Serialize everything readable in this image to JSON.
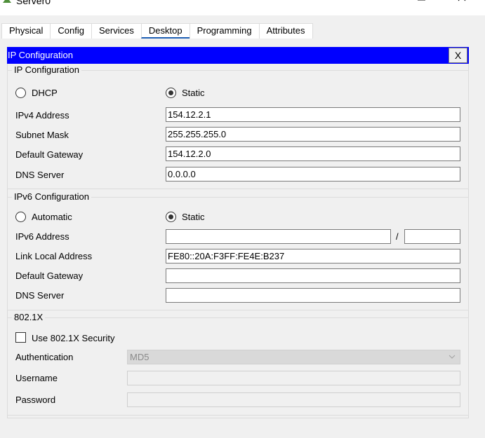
{
  "window": {
    "title": "Server0"
  },
  "tabs": [
    "Physical",
    "Config",
    "Services",
    "Desktop",
    "Programming",
    "Attributes"
  ],
  "active_tab": "Desktop",
  "panel": {
    "title": "IP Configuration",
    "close_label": "X"
  },
  "ipv4": {
    "legend": "IP Configuration",
    "dhcp_label": "DHCP",
    "static_label": "Static",
    "mode": "Static",
    "ipv4_address_label": "IPv4 Address",
    "ipv4_address": "154.12.2.1",
    "subnet_mask_label": "Subnet Mask",
    "subnet_mask": "255.255.255.0",
    "default_gateway_label": "Default Gateway",
    "default_gateway": "154.12.2.0",
    "dns_server_label": "DNS Server",
    "dns_server": "0.0.0.0"
  },
  "ipv6": {
    "legend": "IPv6 Configuration",
    "automatic_label": "Automatic",
    "static_label": "Static",
    "mode": "Static",
    "ipv6_address_label": "IPv6 Address",
    "ipv6_address": "",
    "prefix_separator": "/",
    "prefix_length": "",
    "link_local_label": "Link Local Address",
    "link_local_address": "FE80::20A:F3FF:FE4E:B237",
    "default_gateway_label": "Default Gateway",
    "default_gateway": "",
    "dns_server_label": "DNS Server",
    "dns_server": ""
  },
  "dot1x": {
    "legend": "802.1X",
    "use_security_label": "Use 802.1X Security",
    "use_security_checked": false,
    "authentication_label": "Authentication",
    "authentication_value": "MD5",
    "username_label": "Username",
    "username": "",
    "password_label": "Password",
    "password": ""
  },
  "colors": {
    "panel_header": "#0000ff",
    "active_tab_underline": "#1e5fb4"
  }
}
